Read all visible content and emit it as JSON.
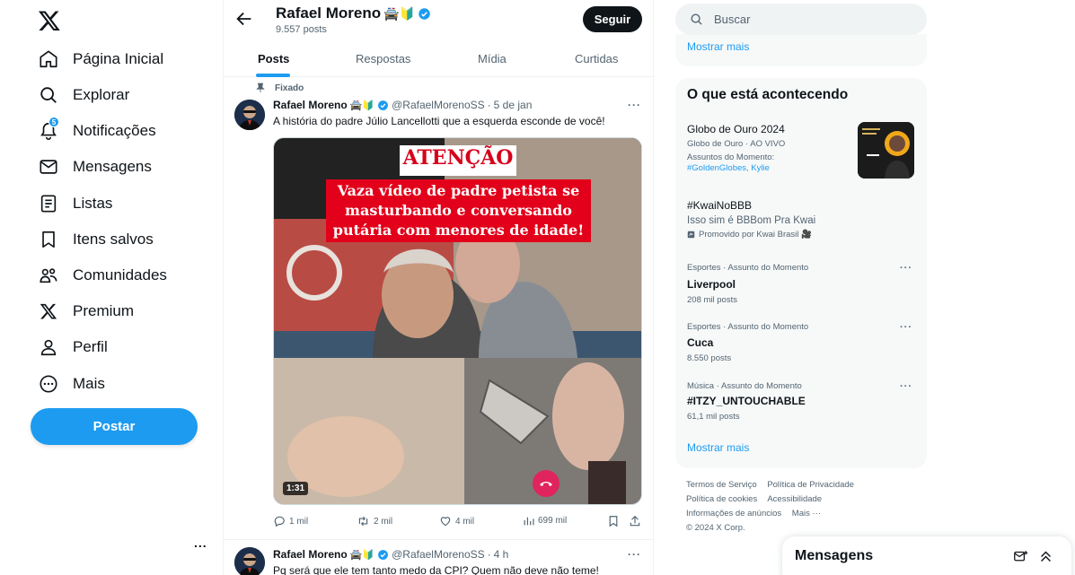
{
  "nav": {
    "items": [
      {
        "label": "Página Inicial",
        "icon": "home-icon"
      },
      {
        "label": "Explorar",
        "icon": "search-icon"
      },
      {
        "label": "Notificações",
        "icon": "bell-icon",
        "badge": "5"
      },
      {
        "label": "Mensagens",
        "icon": "envelope-icon"
      },
      {
        "label": "Listas",
        "icon": "list-icon"
      },
      {
        "label": "Itens salvos",
        "icon": "bookmark-icon"
      },
      {
        "label": "Comunidades",
        "icon": "people-icon"
      },
      {
        "label": "Premium",
        "icon": "x-logo-icon"
      },
      {
        "label": "Perfil",
        "icon": "person-icon"
      },
      {
        "label": "Mais",
        "icon": "more-circle-icon"
      }
    ],
    "post_button": "Postar",
    "more_dots": "..."
  },
  "profile": {
    "name": "Rafael Moreno",
    "emoji": "🚔🔰",
    "post_count": "9.557 posts",
    "follow_label": "Seguir"
  },
  "tabs": [
    {
      "label": "Posts",
      "active": true
    },
    {
      "label": "Respostas",
      "active": false
    },
    {
      "label": "Mídia",
      "active": false
    },
    {
      "label": "Curtidas",
      "active": false
    }
  ],
  "tweets": [
    {
      "pinned_label": "Fixado",
      "name": "Rafael Moreno",
      "emoji": "🚔🔰",
      "handle": "@RafaelMorenoSS",
      "date": "5 de jan",
      "text": "A história do padre Júlio Lancellotti que a esquerda esconde de você!",
      "media": {
        "banner_title": "ATENÇÃO",
        "banner_lines": [
          "Vaza vídeo de padre petista se",
          "masturbando e conversando",
          "putária com menores de idade!"
        ],
        "duration": "1:31"
      },
      "replies": "1 mil",
      "retweets": "2 mil",
      "likes": "4 mil",
      "views": "699 mil"
    },
    {
      "name": "Rafael Moreno",
      "emoji": "🚔🔰",
      "handle": "@RafaelMorenoSS",
      "date": "4 h",
      "text": "Pq será que ele tem tanto medo da CPI? Quem não deve não teme!"
    }
  ],
  "search": {
    "placeholder": "Buscar"
  },
  "right": {
    "show_more_top": "Mostrar mais",
    "trends_title": "O que está acontecendo",
    "trends": [
      {
        "title": "Globo de Ouro 2024",
        "context": "Globo de Ouro · AO VIVO",
        "sub_label": "Assuntos do Momento:",
        "tags": "#GoldenGlobes, Kylie"
      },
      {
        "title": "#KwaiNoBBB",
        "sub": "Isso sim é BBBom Pra Kwai",
        "promo": "Promovido por Kwai Brasil 🎥"
      },
      {
        "context": "Esportes · Assunto do Momento",
        "title": "Liverpool",
        "count": "208 mil posts"
      },
      {
        "context": "Esportes · Assunto do Momento",
        "title": "Cuca",
        "count": "8.550 posts"
      },
      {
        "context": "Música · Assunto do Momento",
        "title": "#ITZY_UNTOUCHABLE",
        "count": "61,1 mil posts"
      }
    ],
    "show_more_bottom": "Mostrar mais",
    "footer": {
      "line1": [
        "Termos de Serviço",
        "Política de Privacidade"
      ],
      "line2": [
        "Política de cookies",
        "Acessibilidade"
      ],
      "line3": [
        "Informações de anúncios",
        "Mais ···"
      ],
      "copyright": "© 2024 X Corp."
    }
  },
  "messages_drawer": {
    "title": "Mensagens"
  },
  "colors": {
    "accent": "#1d9bf0",
    "text": "#0f1419",
    "muted": "#536471",
    "panel": "#f7f9f9",
    "verified": "#1d9bf0"
  }
}
